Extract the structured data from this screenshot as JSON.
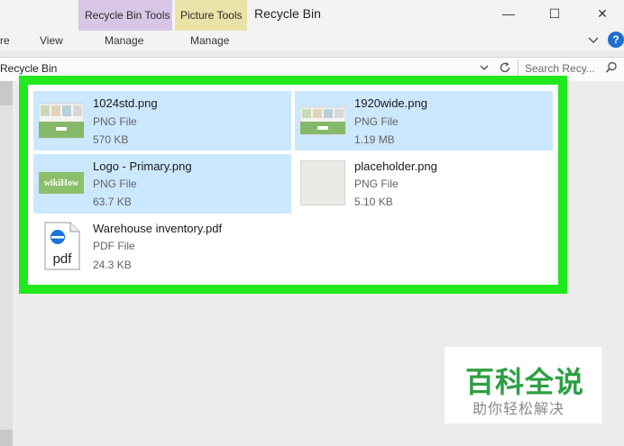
{
  "titlebar": {
    "contextual_tabs": [
      {
        "label": "Recycle Bin Tools",
        "group": "Manage"
      },
      {
        "label": "Picture Tools",
        "group": "Manage"
      }
    ],
    "title": "Recycle Bin",
    "controls": {
      "minimize": "—",
      "maximize": "☐",
      "close": "✕"
    }
  },
  "ribbon": {
    "tabs": [
      "re",
      "View"
    ],
    "help_icon": "?",
    "collapse_icon": "chevron-down-icon"
  },
  "address": {
    "path": "Recycle Bin",
    "search_placeholder": "Search Recy...",
    "dropdown_glyph": "⌄",
    "refresh_glyph": "↻",
    "search_glyph": "⚲"
  },
  "files": [
    {
      "name": "1024std.png",
      "type": "PNG File",
      "size": "570 KB",
      "selected": true,
      "thumb": "landscape-thumb"
    },
    {
      "name": "1920wide.png",
      "type": "PNG File",
      "size": "1.19 MB",
      "selected": true,
      "thumb": "landscape-thumb"
    },
    {
      "name": "Logo - Primary.png",
      "type": "PNG File",
      "size": "63.7 KB",
      "selected": true,
      "thumb": "logo-thumb",
      "logo_text": "wikiHow"
    },
    {
      "name": "placeholder.png",
      "type": "PNG File",
      "size": "5.10 KB",
      "selected": false,
      "thumb": "blank-thumb"
    },
    {
      "name": "Warehouse inventory.pdf",
      "type": "PDF File",
      "size": "24.3 KB",
      "selected": false,
      "thumb": "pdf-icon",
      "pdf_label": "pdf"
    }
  ],
  "watermark": {
    "title": "百科全说",
    "subtitle": "助你轻松解决"
  },
  "colors": {
    "selection": "#cce8ff",
    "highlight_frame": "#22e81e",
    "recycle_tab": "#d9c6e6",
    "picture_tab": "#e9e3a7",
    "help": "#1e6fd0"
  }
}
